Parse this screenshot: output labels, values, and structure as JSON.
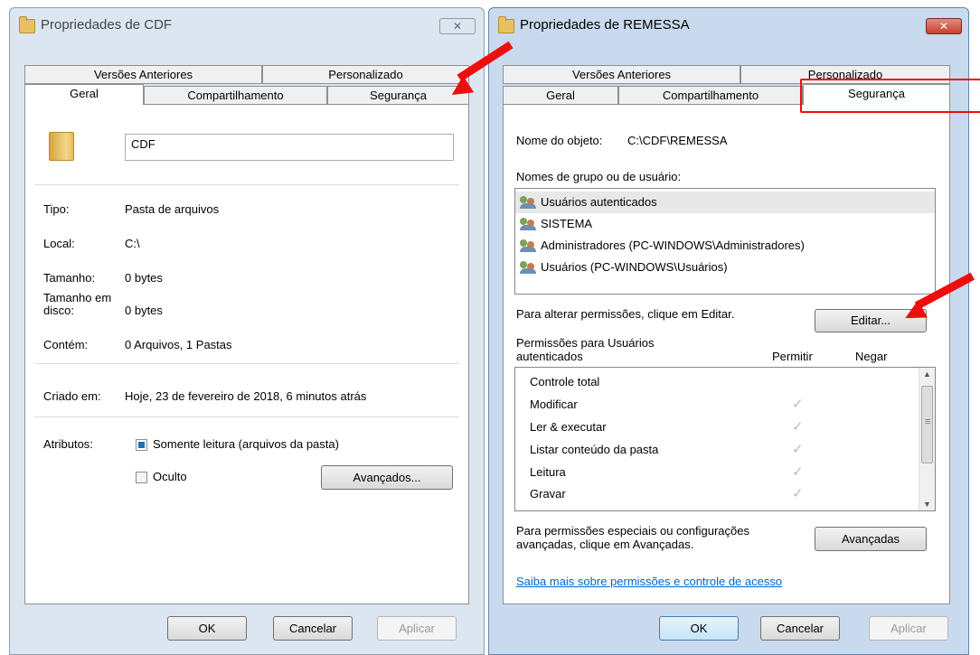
{
  "left_window": {
    "title": "Propriedades de CDF",
    "close_symbol": "✕",
    "tabs_top": [
      "Versões Anteriores",
      "Personalizado"
    ],
    "tabs_bottom": [
      "Geral",
      "Compartilhamento",
      "Segurança"
    ],
    "name_value": "CDF",
    "fields": {
      "tipo_label": "Tipo:",
      "tipo_value": "Pasta de arquivos",
      "local_label": "Local:",
      "local_value": "C:\\",
      "tamanho_label": "Tamanho:",
      "tamanho_value": "0 bytes",
      "tamanho_disco_label": "Tamanho em disco:",
      "tamanho_disco_value": "0 bytes",
      "contem_label": "Contém:",
      "contem_value": "0 Arquivos, 1 Pastas",
      "criado_label": "Criado em:",
      "criado_value": "Hoje, 23 de fevereiro de 2018, 6 minutos atrás",
      "atributos_label": "Atributos:"
    },
    "attributes": {
      "readonly_label": "Somente leitura (arquivos da pasta)",
      "readonly_checked": true,
      "hidden_label": "Oculto",
      "hidden_checked": false,
      "advanced_button": "Avançados..."
    },
    "buttons": {
      "ok": "OK",
      "cancel": "Cancelar",
      "apply": "Aplicar"
    }
  },
  "right_window": {
    "title": "Propriedades de REMESSA",
    "close_symbol": "✕",
    "tabs_top": [
      "Versões Anteriores",
      "Personalizado"
    ],
    "tabs_bottom": [
      "Geral",
      "Compartilhamento",
      "Segurança"
    ],
    "object_label": "Nome do objeto:",
    "object_value": "C:\\CDF\\REMESSA",
    "groups_label": "Nomes de grupo ou de usuário:",
    "groups": [
      "Usuários autenticados",
      "SISTEMA",
      "Administradores (PC-WINDOWS\\Administradores)",
      "Usuários (PC-WINDOWS\\Usuários)"
    ],
    "edit_hint": "Para alterar permissões, clique em Editar.",
    "edit_button": "Editar...",
    "permissions_label_1": "Permissões para Usuários",
    "permissions_label_2": "autenticados",
    "allow_header": "Permitir",
    "deny_header": "Negar",
    "permissions": [
      {
        "name": "Controle total",
        "allow": false
      },
      {
        "name": "Modificar",
        "allow": true
      },
      {
        "name": "Ler & executar",
        "allow": true
      },
      {
        "name": "Listar conteúdo da pasta",
        "allow": true
      },
      {
        "name": "Leitura",
        "allow": true
      },
      {
        "name": "Gravar",
        "allow": true
      }
    ],
    "check_symbol": "✓",
    "scroll_up": "▲",
    "scroll_down": "▼",
    "scroll_grip": "≡",
    "advanced_hint_1": "Para permissões especiais ou configurações",
    "advanced_hint_2": "avançadas, clique em Avançadas.",
    "advanced_button": "Avançadas",
    "learn_more_link": "Saiba mais sobre permissões e controle de acesso",
    "buttons": {
      "ok": "OK",
      "cancel": "Cancelar",
      "apply": "Aplicar"
    }
  },
  "colors": {
    "annotation_red": "#ef0d0d",
    "link_blue": "#0066cc",
    "checkbox_blue": "#1f6fb6"
  }
}
